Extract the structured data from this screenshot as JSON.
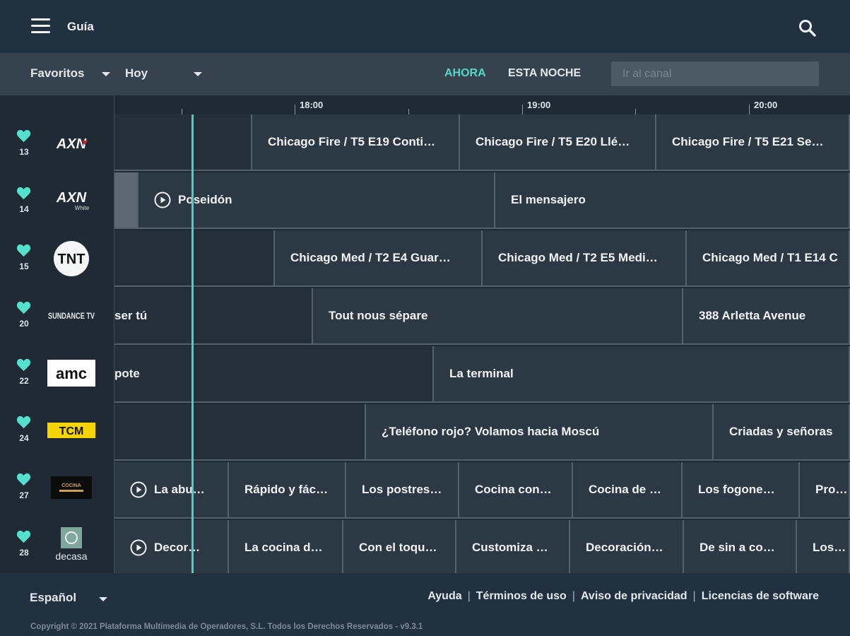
{
  "header": {
    "title": "Guía"
  },
  "filters": {
    "favorites": "Favoritos",
    "day": "Hoy",
    "tab_now": "AHORA",
    "tab_tonight": "ESTA NOCHE",
    "channel_placeholder": "Ir al canal"
  },
  "timeline": {
    "labels": [
      "18:00",
      "19:00",
      "20:00"
    ]
  },
  "channels": [
    {
      "number": "13",
      "logo": "AXN",
      "favorite": true
    },
    {
      "number": "14",
      "logo": "AXN White",
      "favorite": true
    },
    {
      "number": "15",
      "logo": "TNT",
      "favorite": true
    },
    {
      "number": "20",
      "logo": "SUNDANCE TV",
      "favorite": true
    },
    {
      "number": "22",
      "logo": "amc",
      "favorite": true
    },
    {
      "number": "24",
      "logo": "TCM",
      "favorite": true
    },
    {
      "number": "27",
      "logo": "Canal Cocina",
      "favorite": true
    },
    {
      "number": "28",
      "logo": "decasa",
      "favorite": true
    }
  ],
  "programs": [
    [
      "",
      "Chicago Fire / T5 E19 Conti…",
      "Chicago Fire / T5 E20 Llé…",
      "Chicago Fire / T5 E21 Se…"
    ],
    [
      "",
      "Poseidón",
      "El mensajero"
    ],
    [
      "",
      "Chicago Med / T2 E4 Guar…",
      "Chicago Med / T2 E5 Medi…",
      "Chicago Med / T1 E14 C"
    ],
    [
      "ser tú",
      "Tout nous sépare",
      "388 Arletta Avenue"
    ],
    [
      "pote",
      "La terminal"
    ],
    [
      "",
      "¿Teléfono rojo? Volamos hacia Moscú",
      "Criadas y señoras"
    ],
    [
      "La abu…",
      "Rápido y fác…",
      "Los postres…",
      "Cocina con…",
      "Cocina de …",
      "Los fogone…",
      "Produ"
    ],
    [
      "Decor…",
      "La cocina d…",
      "Con el toqu…",
      "Customiza …",
      "Decoración…",
      "De sin a co…",
      "Los ge"
    ]
  ],
  "footer": {
    "language": "Español",
    "links": [
      "Ayuda",
      "Términos de uso",
      "Aviso de privacidad",
      "Licencias de software"
    ],
    "copyright": "Copyright © 2021 Plataforma Multimedia de Operadores, S.L. Todos los Derechos Reservados - v9.3.1"
  },
  "colors": {
    "accent": "#44d4bd",
    "background": "#1f2a35",
    "bar": "#223140"
  }
}
